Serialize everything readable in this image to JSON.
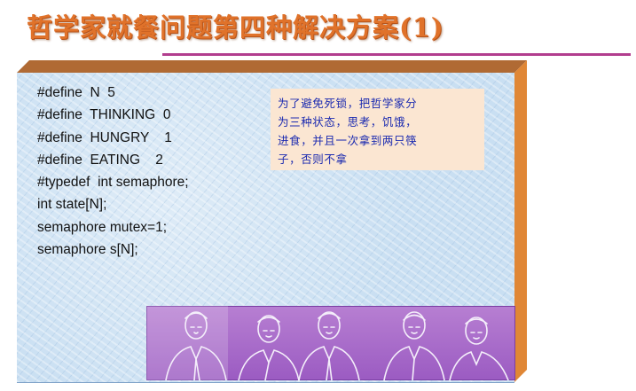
{
  "slide": {
    "title": "哲学家就餐问题第四种解决方案(1)",
    "code_lines": [
      "#define  N  5",
      "#define  THINKING  0",
      "#define  HUNGRY    1",
      "#define  EATING    2",
      "#typedef  int semaphore;",
      "int state[N];",
      "semaphore mutex=1;",
      "semaphore s[N];"
    ],
    "note_lines": [
      "为了避免死锁，把哲学家分",
      "为三种状态，思考，饥饿，",
      "进食，并且一次拿到两只筷",
      "子，否则不拿"
    ],
    "picture": {
      "subject": "five-men-sketch"
    },
    "colors": {
      "title": "#e0722a",
      "rule": "#b23d8e",
      "panel": "#c9dff2",
      "note_bg": "#fbe6d2",
      "note_text": "#1c2bb0",
      "picture_bg": "#9b5bc2"
    }
  }
}
